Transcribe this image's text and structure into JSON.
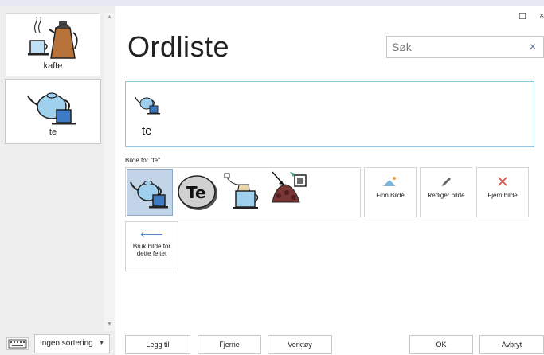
{
  "sidebar": {
    "words": [
      {
        "label": "kaffe",
        "icon": "coffee-pot-icon"
      },
      {
        "label": "te",
        "icon": "teapot-icon",
        "selected": true
      }
    ],
    "sort": {
      "value": "Ingen sortering"
    },
    "scroll_up": "▲",
    "scroll_down": "▼",
    "keyboard_icon": "keyboard-icon",
    "sort_caret": "▼"
  },
  "window": {
    "maximize": "☐",
    "close": "×"
  },
  "main": {
    "title": "Ordliste",
    "search": {
      "placeholder": "Søk",
      "clear": "×"
    },
    "preview": {
      "word": "te",
      "icon": "teapot-icon"
    },
    "picture_section_label": "Bilde for \"te\"",
    "picture_options": [
      {
        "icon": "teapot-icon",
        "selected": true
      },
      {
        "icon": "te-disc-icon",
        "text": "Te"
      },
      {
        "icon": "teabag-cup-icon"
      },
      {
        "icon": "tea-leaves-icon"
      }
    ],
    "actions": [
      {
        "label": "Finn Bilde",
        "icon": "mountain-sun-icon"
      },
      {
        "label": "Rediger bilde",
        "icon": "pencil-icon"
      },
      {
        "label": "Fjern bilde",
        "icon": "remove-x-icon"
      }
    ],
    "use_picture": {
      "label": "Bruk bilde for dette feltet",
      "icon": "arrow-left-icon",
      "arrow": "🡐"
    }
  },
  "footer": {
    "add": "Legg til",
    "remove": "Fjerne",
    "tools": "Verktøy",
    "ok": "OK",
    "cancel": "Avbryt"
  },
  "colors": {
    "accent_border": "#8fc6e6",
    "selected_bg": "#c2d4e8",
    "remove_red": "#d9534f",
    "action_blue": "#3d7cc4"
  }
}
